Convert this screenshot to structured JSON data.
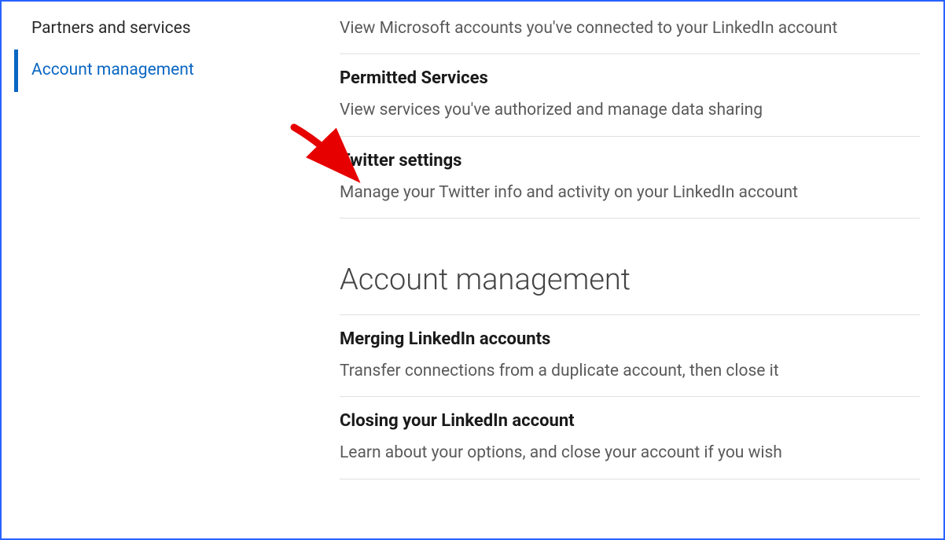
{
  "sidebar": {
    "items": [
      {
        "label": "Partners and services",
        "active": false
      },
      {
        "label": "Account management",
        "active": true
      }
    ]
  },
  "main": {
    "microsoft": {
      "desc": "View Microsoft accounts you've connected to your LinkedIn account"
    },
    "permitted": {
      "title": "Permitted Services",
      "desc": "View services you've authorized and manage data sharing"
    },
    "twitter": {
      "title": "Twitter settings",
      "desc": "Manage your Twitter info and activity on your LinkedIn account"
    },
    "section_heading": "Account management",
    "merging": {
      "title": "Merging LinkedIn accounts",
      "desc": "Transfer connections from a duplicate account, then close it"
    },
    "closing": {
      "title": "Closing your LinkedIn account",
      "desc": "Learn about your options, and close your account if you wish"
    }
  }
}
